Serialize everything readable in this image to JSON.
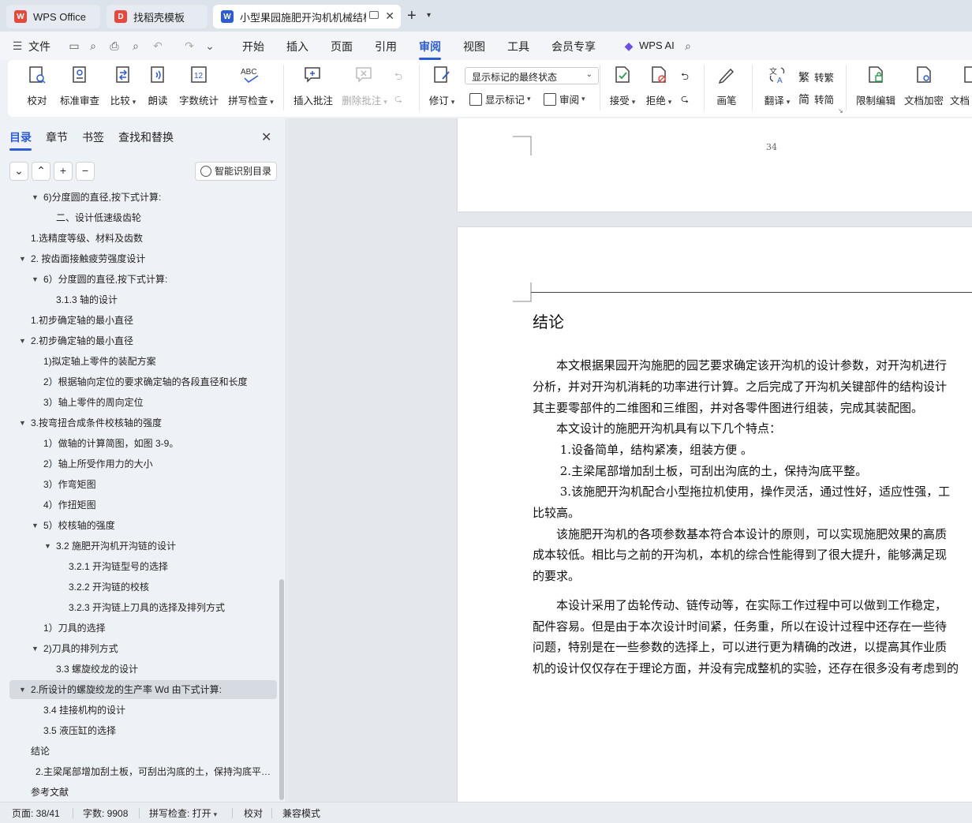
{
  "tabs": [
    {
      "label": "WPS Office",
      "color": "#e8483b"
    },
    {
      "label": "找稻壳模板",
      "color": "#e8483b"
    },
    {
      "label": "小型果园施肥开沟机机械结构",
      "color": "#2b5bd7"
    }
  ],
  "menu": {
    "file": "文件",
    "items": [
      "开始",
      "插入",
      "页面",
      "引用",
      "审阅",
      "视图",
      "工具",
      "会员专享"
    ],
    "active": "审阅",
    "ai": "WPS AI"
  },
  "ribbon": {
    "proofread": "校对",
    "standard_review": "标准审查",
    "compare": "比较",
    "read_aloud": "朗读",
    "word_count": "字数统计",
    "spell_check": "拼写检查",
    "insert_comment": "插入批注",
    "delete_comment": "删除批注",
    "revise": "修订",
    "display_state": "显示标记的最终状态",
    "show_markup": "显示标记",
    "review": "审阅",
    "accept": "接受",
    "reject": "拒绝",
    "pen": "画笔",
    "translate": "翻译",
    "to_traditional": "转繁",
    "to_simplified": "转简",
    "restrict_edit": "限制编辑",
    "doc_encrypt": "文档加密",
    "doc_more": "文档"
  },
  "panel": {
    "tabs": [
      "目录",
      "章节",
      "书签",
      "查找和替换"
    ],
    "smart_toc": "智能识别目录",
    "toc": [
      {
        "text": "6)分度圆的直径,按下式计算:",
        "level": 2,
        "tri": true
      },
      {
        "text": "二、设计低速级齿轮",
        "level": 3,
        "tri": false
      },
      {
        "text": "1.选精度等级、材料及齿数",
        "level": 1,
        "tri": false
      },
      {
        "text": "2. 按齿面接触疲劳强度设计",
        "level": 1,
        "tri": true
      },
      {
        "text": "6）分度圆的直径,按下式计算:",
        "level": 2,
        "tri": true
      },
      {
        "text": "3.1.3 轴的设计",
        "level": 3,
        "tri": false
      },
      {
        "text": "1.初步确定轴的最小直径",
        "level": 1,
        "tri": false
      },
      {
        "text": "2.初步确定轴的最小直径",
        "level": 1,
        "tri": true
      },
      {
        "text": "1)拟定轴上零件的装配方案",
        "level": 2,
        "tri": false
      },
      {
        "text": "2）根据轴向定位的要求确定轴的各段直径和长度",
        "level": 2,
        "tri": false
      },
      {
        "text": "3）轴上零件的周向定位",
        "level": 2,
        "tri": false
      },
      {
        "text": "3.按弯扭合成条件校核轴的强度",
        "level": 1,
        "tri": true
      },
      {
        "text": "1）做轴的计算简图，如图 3-9。",
        "level": 2,
        "tri": false
      },
      {
        "text": "2）轴上所受作用力的大小",
        "level": 2,
        "tri": false
      },
      {
        "text": "3）作弯矩图",
        "level": 2,
        "tri": false
      },
      {
        "text": "4）作扭矩图",
        "level": 2,
        "tri": false
      },
      {
        "text": "5）校核轴的强度",
        "level": 2,
        "tri": true
      },
      {
        "text": "3.2 施肥开沟机开沟链的设计",
        "level": 3,
        "tri": true
      },
      {
        "text": "3.2.1 开沟链型号的选择",
        "level": 4,
        "tri": false
      },
      {
        "text": "3.2.2 开沟链的校核",
        "level": 4,
        "tri": false
      },
      {
        "text": "3.2.3 开沟链上刀具的选择及排列方式",
        "level": 4,
        "tri": false
      },
      {
        "text": "1）刀具的选择",
        "level": 2,
        "tri": false
      },
      {
        "text": "2)刀具的排列方式",
        "level": 2,
        "tri": true
      },
      {
        "text": "3.3 螺旋绞龙的设计",
        "level": 3,
        "tri": false
      },
      {
        "text": "2.所设计的螺旋绞龙的生产率 Wd 由下式计算:",
        "level": 1,
        "tri": true,
        "selected": true
      },
      {
        "text": "3.4 挂接机构的设计",
        "level": 2,
        "tri": false
      },
      {
        "text": "3.5 液压缸的选择",
        "level": 2,
        "tri": false
      },
      {
        "text": "结论",
        "level": 1,
        "tri": false
      },
      {
        "text": "2.主梁尾部增加刮土板，可刮出沟底的土，保持沟底平…",
        "level": 1.4,
        "tri": false
      },
      {
        "text": "参考文献",
        "level": 1,
        "tri": false
      }
    ]
  },
  "document": {
    "page_number": "34",
    "heading": "结论",
    "paragraphs": [
      "　　本文根据果园开沟施肥的园艺要求确定该开沟机的设计参数，对开沟机进行",
      "分析，并对开沟机消耗的功率进行计算。之后完成了开沟机关键部件的结构设计",
      "其主要零部件的二维图和三维图，并对各零件图进行组装，完成其装配图。",
      "　　本文设计的施肥开沟机具有以下几个特点：",
      "　　 1.设备简单，结构紧凑，组装方便 。",
      "　　 2.主梁尾部增加刮土板，可刮出沟底的土，保持沟底平整。",
      "　　 3.该施肥开沟机配合小型拖拉机使用，操作灵活，通过性好，适应性强，工",
      "比较高。",
      "　　该施肥开沟机的各项参数基本符合本设计的原则，可以实现施肥效果的高质",
      "成本较低。相比与之前的开沟机，本机的综合性能得到了很大提升，能够满足现",
      "的要求。",
      "　　本设计采用了齿轮传动、链传动等，在实际工作过程中可以做到工作稳定，",
      "配件容易。但是由于本次设计时间紧，任务重，所以在设计过程中还存在一些待",
      "问题，特别是在一些参数的选择上，可以进行更为精确的改进，以提高其作业质",
      "机的设计仅仅存在于理论方面，并没有完成整机的实验，还存在很多没有考虑到的"
    ]
  },
  "status": {
    "page": "页面: 38/41",
    "words": "字数: 9908",
    "spell": "拼写检查: 打开",
    "proof": "校对",
    "compat": "兼容模式"
  },
  "colors": {
    "accent": "#2b5bd7",
    "wps_red": "#e8483b"
  }
}
